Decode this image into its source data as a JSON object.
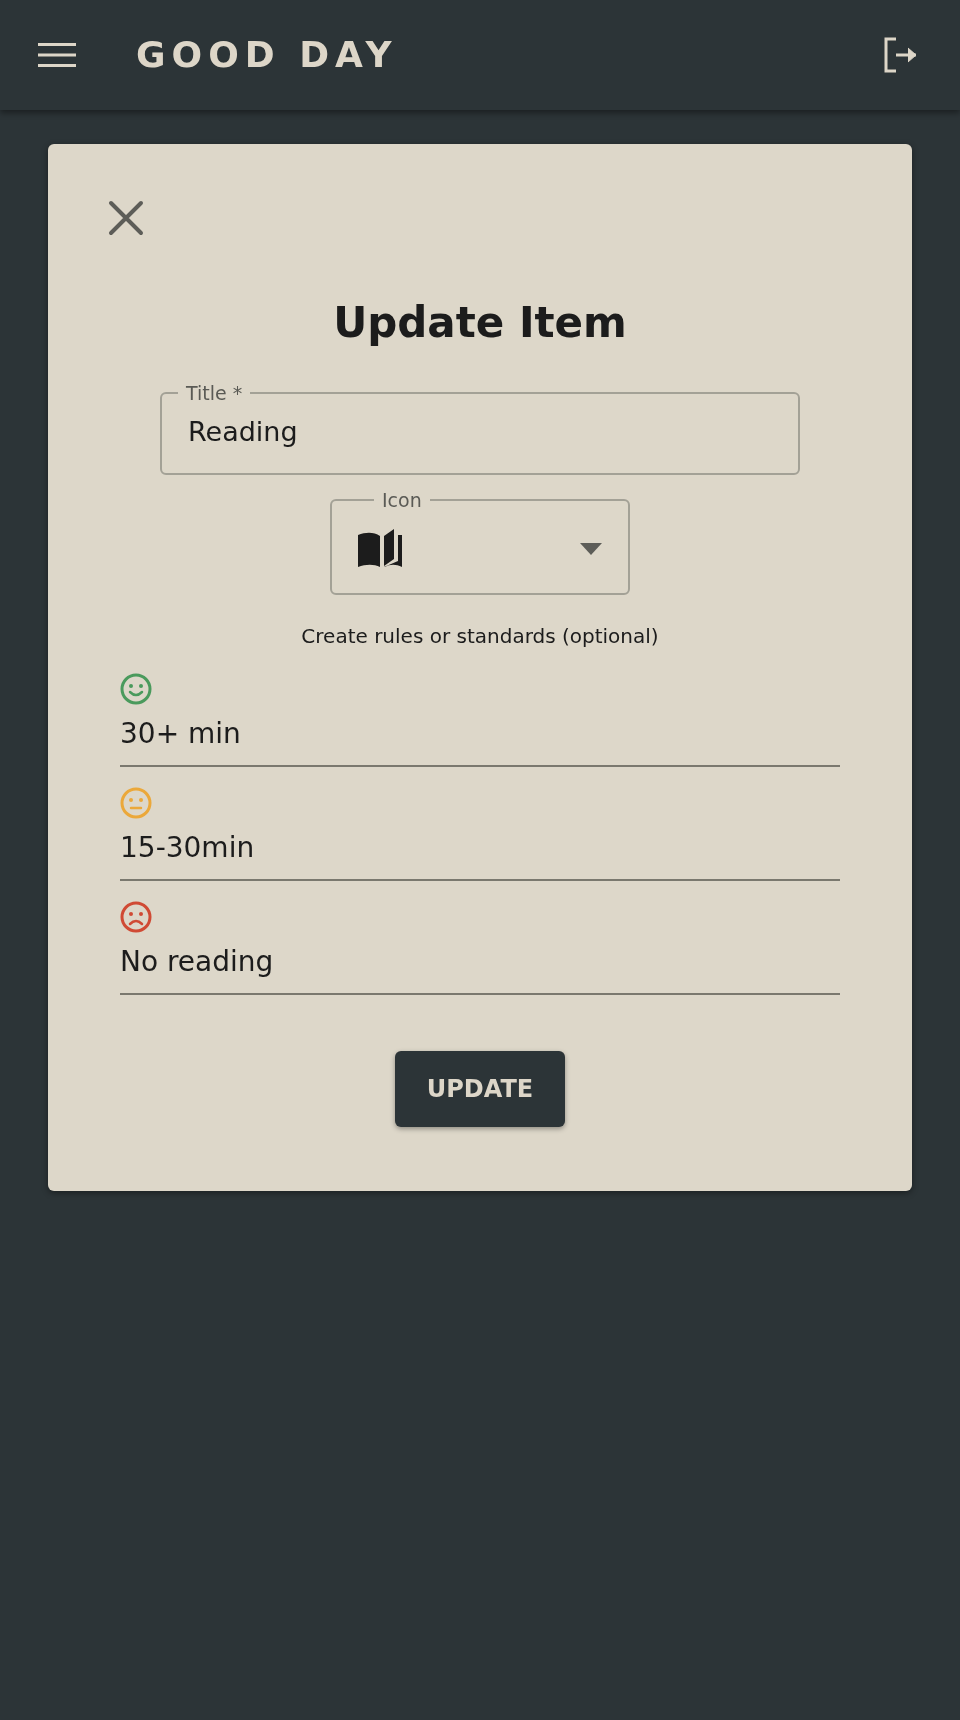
{
  "app_bar": {
    "title": "GOOD DAY"
  },
  "dialog": {
    "title": "Update Item",
    "title_field": {
      "label": "Title *",
      "value": "Reading"
    },
    "icon_field": {
      "label": "Icon"
    },
    "rules_caption": "Create rules or standards (optional)",
    "rules": [
      {
        "kind": "happy",
        "color": "#4a9a5c",
        "value": "30+ min"
      },
      {
        "kind": "neutral",
        "color": "#eba83a",
        "value": "15-30min"
      },
      {
        "kind": "sad",
        "color": "#d04a34",
        "value": "No reading"
      }
    ],
    "button": "UPDATE"
  }
}
